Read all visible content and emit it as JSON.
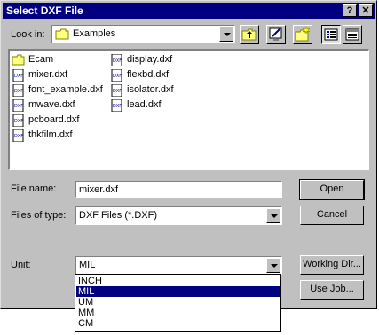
{
  "window": {
    "title": "Select DXF File",
    "help_button": "?",
    "close_button": "✕"
  },
  "look_in": {
    "label": "Look in:",
    "value": "Examples"
  },
  "files": [
    {
      "name": "Ecam",
      "type": "folder"
    },
    {
      "name": "mixer.dxf",
      "type": "dxf"
    },
    {
      "name": "font_example.dxf",
      "type": "dxf"
    },
    {
      "name": "mwave.dxf",
      "type": "dxf"
    },
    {
      "name": "pcboard.dxf",
      "type": "dxf"
    },
    {
      "name": "thkfilm.dxf",
      "type": "dxf"
    },
    {
      "name": "display.dxf",
      "type": "dxf"
    },
    {
      "name": "flexbd.dxf",
      "type": "dxf"
    },
    {
      "name": "isolator.dxf",
      "type": "dxf"
    },
    {
      "name": "lead.dxf",
      "type": "dxf"
    }
  ],
  "file_name": {
    "label": "File name:",
    "value": "mixer.dxf"
  },
  "files_of_type": {
    "label": "Files of type:",
    "value": "DXF Files (*.DXF)"
  },
  "unit": {
    "label": "Unit:",
    "value": "MIL",
    "options": [
      "INCH",
      "MIL",
      "UM",
      "MM",
      "CM"
    ],
    "selected_index": 1
  },
  "buttons": {
    "open": "Open",
    "cancel": "Cancel",
    "working_dir": "Working Dir...",
    "use_job": "Use Job..."
  },
  "colors": {
    "title_bar": "#000080",
    "face": "#c0c0c0",
    "selection": "#000080"
  }
}
